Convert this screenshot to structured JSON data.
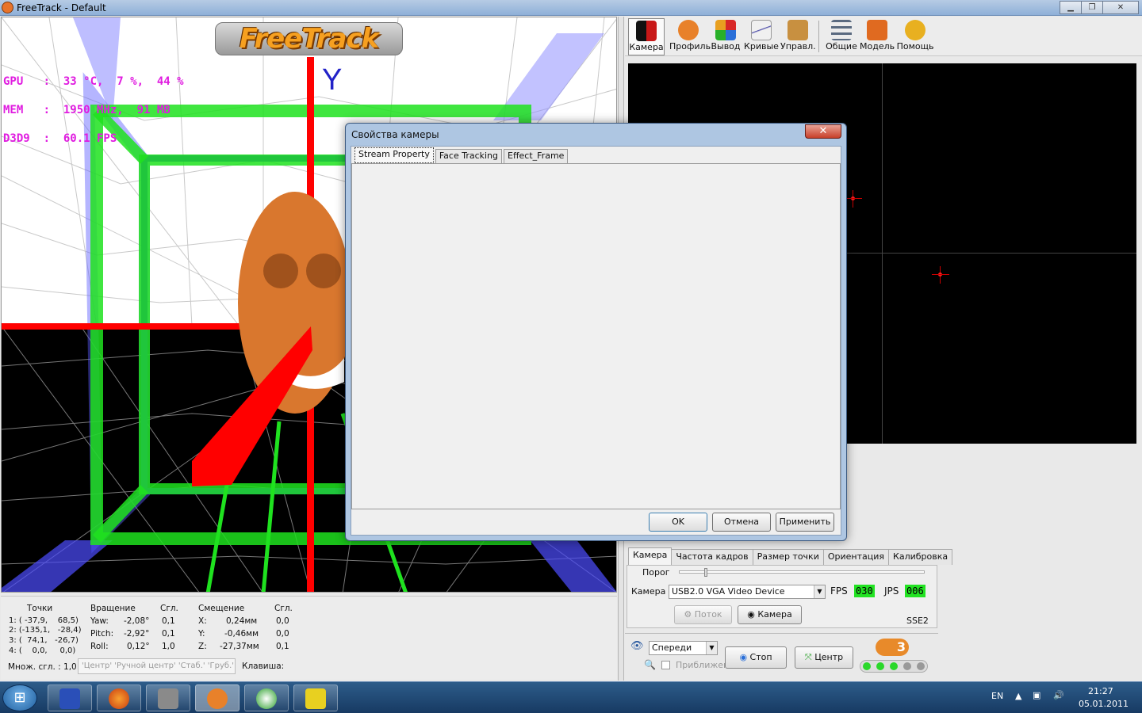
{
  "window": {
    "title": "FreeTrack - Default"
  },
  "viewport": {
    "logo": "FreeTrack",
    "osd_lines": [
      "GPU   :  33 °C,  7 %,  44 %",
      "MEM   :  1950 MHz,  91 MB",
      "D3D9  :  60.1 FPS"
    ],
    "axis_label": "Y"
  },
  "stats": {
    "points_header": "Точки",
    "points": [
      "1: ( -37,9,    68,5)",
      "2: (-135,1,   -28,4)",
      "3: (  74,1,   -26,7)",
      "4: (    0,0,     0,0)"
    ],
    "rotation_header": "Вращение",
    "smooth_header": "Сгл.",
    "offset_header": "Смещение",
    "smooth2_header": "Сгл.",
    "rot_labels": [
      "Yaw:",
      "Pitch:",
      "Roll:"
    ],
    "rot_values": [
      "-2,08°",
      "-2,92°",
      "0,12°"
    ],
    "rot_smooth": [
      "0,1",
      "0,1",
      "1,0"
    ],
    "off_labels": [
      "X:",
      "Y:",
      "Z:"
    ],
    "off_values": [
      "0,24мм",
      "-0,46мм",
      "-27,37мм"
    ],
    "off_smooth": [
      "0,0",
      "0,0",
      "0,1"
    ],
    "multiplier": "Множ. сгл. : 1,0",
    "tags": "'Центр' 'Ручной центр'  'Стаб.'  'Груб.'",
    "key_label": "Клавиша:"
  },
  "toolbar": {
    "items": [
      {
        "label": "Камера",
        "icon": "camera-icon",
        "color": "#c81818"
      },
      {
        "label": "Профиль",
        "icon": "profile-icon",
        "color": "#e8812a"
      },
      {
        "label": "Вывод",
        "icon": "output-icon",
        "color": "#2a6fd8"
      },
      {
        "label": "Кривые",
        "icon": "curves-icon",
        "color": "#3a3aa0"
      },
      {
        "label": "Управл.",
        "icon": "control-icon",
        "color": "#c89040"
      },
      {
        "label": "Общие",
        "icon": "settings-icon",
        "color": "#5a6a80"
      },
      {
        "label": "Модель",
        "icon": "model-icon",
        "color": "#e06a20"
      },
      {
        "label": "Помощь",
        "icon": "help-icon",
        "color": "#e8b020"
      }
    ]
  },
  "camera_tabs": [
    "Камера",
    "Частота кадров",
    "Размер точки",
    "Ориентация",
    "Калибровка"
  ],
  "camera_panel": {
    "threshold_label": "Порог",
    "threshold_level": 0.1,
    "camera_label": "Камера",
    "device": "USB2.0 VGA Video Device",
    "fps_label": "FPS",
    "fps_value": "030",
    "jps_label": "JPS",
    "jps_value": "006",
    "stream_button": "Поток",
    "camera_button": "Камера",
    "sse": "SSE2"
  },
  "bottom_controls": {
    "view_select": "Спереди",
    "zoom_label": "Приближен",
    "stop_button": "Стоп",
    "center_button": "Центр"
  },
  "dialog": {
    "title": "Свойства камеры",
    "tabs": [
      "Stream Property",
      "Face Tracking",
      "Effect_Frame"
    ],
    "ok": "OK",
    "cancel": "Отмена",
    "apply": "Применить"
  },
  "tray": {
    "lang": "EN",
    "time": "21:27",
    "date": "05.01.2011"
  }
}
